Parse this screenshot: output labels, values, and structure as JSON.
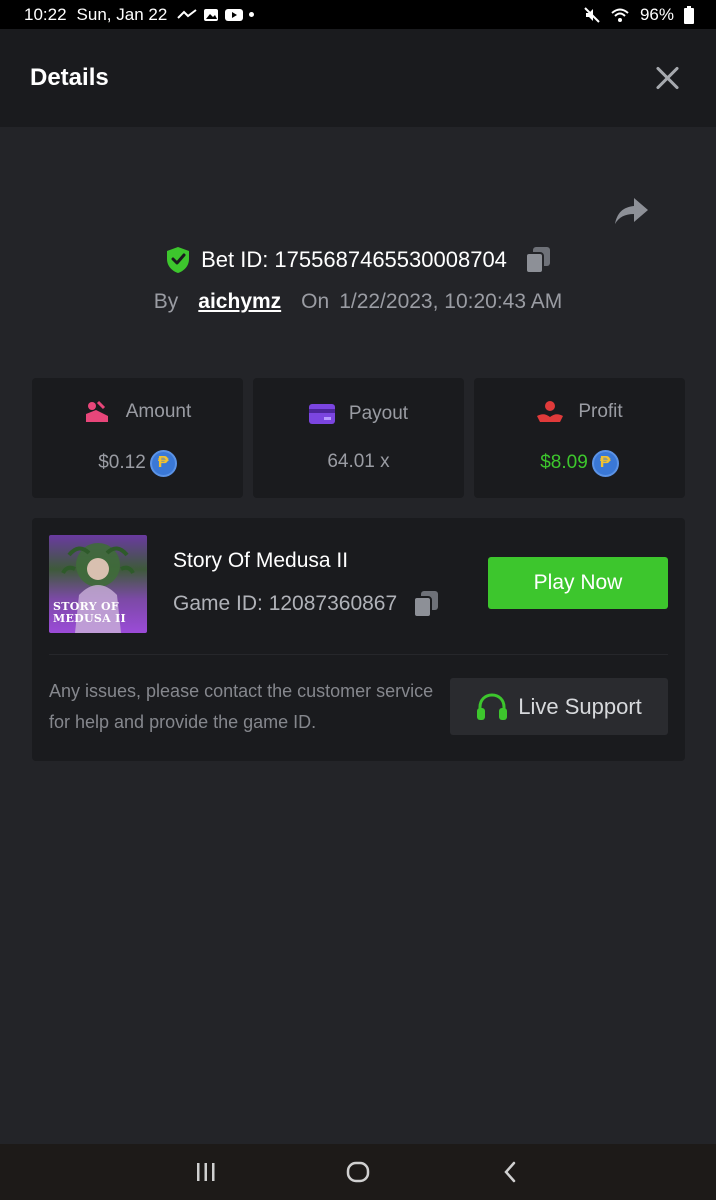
{
  "status_bar": {
    "time": "10:22",
    "date": "Sun, Jan 22",
    "battery": "96%"
  },
  "header": {
    "title": "Details"
  },
  "bet": {
    "label": "Bet ID: 1755687465530008704",
    "by_label": "By",
    "user": "aichymz",
    "on_label": "On",
    "timestamp": "1/22/2023, 10:20:43 AM"
  },
  "stats": {
    "amount": {
      "label": "Amount",
      "value": "$0.12"
    },
    "payout": {
      "label": "Payout",
      "value": "64.01 x"
    },
    "profit": {
      "label": "Profit",
      "value": "$8.09"
    }
  },
  "coin_symbol": "₱",
  "game": {
    "name": "Story Of Medusa II",
    "id_label": "Game ID: 12087360867",
    "thumb_text_line1": "STORY OF",
    "thumb_text_line2": "MEDUSA II",
    "play_label": "Play Now"
  },
  "help": {
    "text": "Any issues, please contact the customer service for help and provide the game ID.",
    "support_label": "Live Support"
  },
  "colors": {
    "accent_green": "#3dc62d",
    "amount_pink": "#e8467a",
    "payout_purple": "#7b45e0",
    "profit_red": "#e03a3a"
  }
}
